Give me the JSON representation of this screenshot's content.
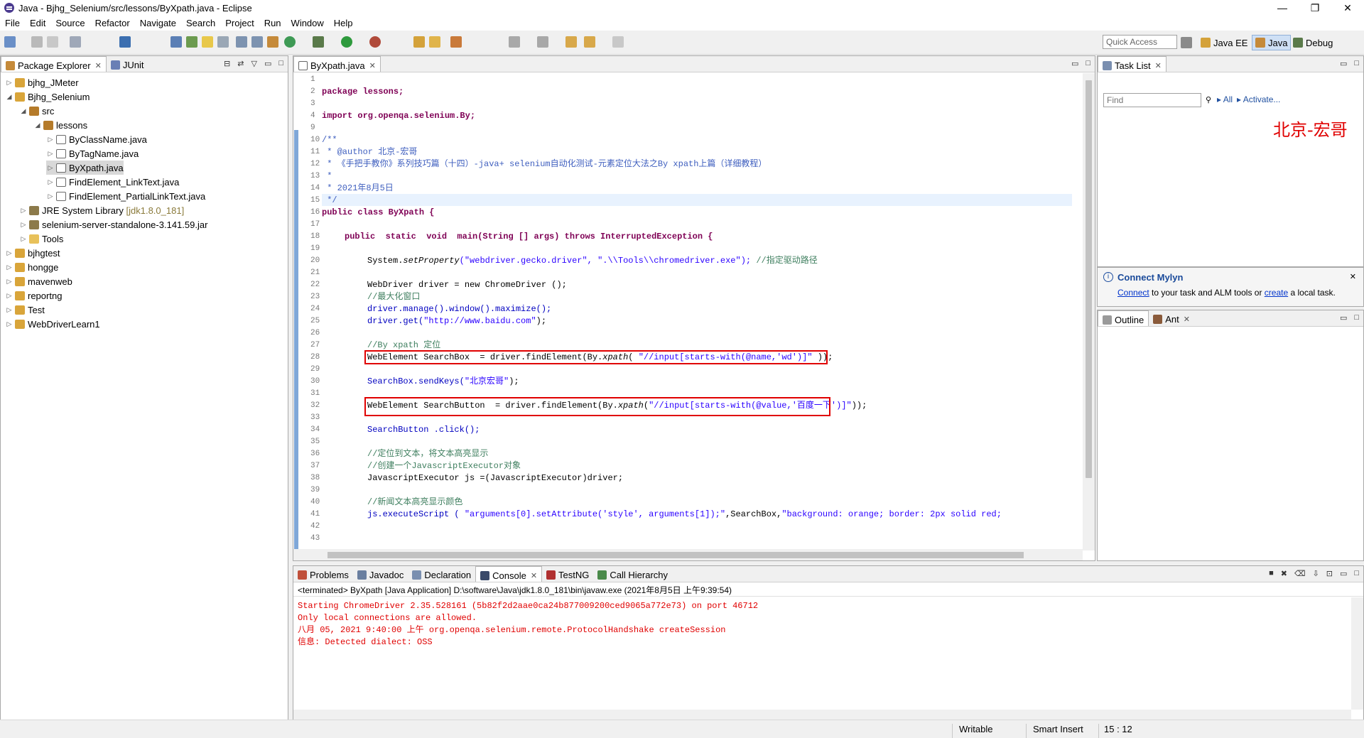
{
  "window": {
    "title": "Java - Bjhg_Selenium/src/lessons/ByXpath.java - Eclipse",
    "min": "—",
    "max": "❐",
    "close": "✕"
  },
  "menu": [
    "File",
    "Edit",
    "Source",
    "Refactor",
    "Navigate",
    "Search",
    "Project",
    "Run",
    "Window",
    "Help"
  ],
  "toolbar": {
    "quick_access": "Quick Access",
    "perspectives": [
      "Java EE",
      "Java",
      "Debug"
    ]
  },
  "package_explorer": {
    "tabs": [
      "Package Explorer",
      "JUnit"
    ],
    "tree": [
      {
        "label": "bjhg_JMeter"
      },
      {
        "label": "Bjhg_Selenium"
      },
      {
        "label": "src"
      },
      {
        "label": "lessons"
      },
      {
        "label": "ByClassName.java"
      },
      {
        "label": "ByTagName.java"
      },
      {
        "label": "ByXpath.java"
      },
      {
        "label": "FindElement_LinkText.java"
      },
      {
        "label": "FindElement_PartialLinkText.java"
      },
      {
        "label": "JRE System Library",
        "suffix": "[jdk1.8.0_181]"
      },
      {
        "label": "selenium-server-standalone-3.141.59.jar"
      },
      {
        "label": "Tools"
      },
      {
        "label": "bjhgtest"
      },
      {
        "label": "hongge"
      },
      {
        "label": "mavenweb"
      },
      {
        "label": "reportng"
      },
      {
        "label": "Test"
      },
      {
        "label": "WebDriverLearn1"
      }
    ]
  },
  "editor": {
    "tab": "ByXpath.java",
    "line_numbers": [
      "1",
      "2",
      "3",
      "4",
      "9",
      "10",
      "11",
      "12",
      "13",
      "14",
      "15",
      "16",
      "17",
      "18",
      "19",
      "20",
      "21",
      "22",
      "23",
      "24",
      "25",
      "26",
      "27",
      "28",
      "29",
      "30",
      "31",
      "32",
      "33",
      "34",
      "35",
      "36",
      "37",
      "38",
      "39",
      "40",
      "41",
      "42",
      "43"
    ],
    "lines": {
      "l2": "package lessons;",
      "l4": "import org.openqa.selenium.By;",
      "l10": "/**",
      "l11a": " * @author ",
      "l11b": "北京-宏哥",
      "l12": " * 《手把手教你》系列技巧篇（十四）-java+ selenium自动化测试-元素定位大法之By xpath上篇（详细教程）",
      "l13": " *",
      "l14": " * 2021年8月5日",
      "l15": " */",
      "l16": "public class ByXpath {",
      "l18": "public  static  void  main(String [] args) throws InterruptedException {",
      "l20a": "System.",
      "l20b": "setProperty",
      "l20c": "(\"webdriver.gecko.driver\", \".\\\\Tools\\\\chromedriver.exe\"); ",
      "l20d": "//指定驱动路径",
      "l22": "WebDriver driver = new ChromeDriver ();",
      "l23": "//最大化窗口",
      "l24": "driver.manage().window().maximize();",
      "l25a": "driver.get(",
      "l25b": "\"http://www.baidu.com\"",
      "l25c": ");",
      "l27": "//By xpath 定位",
      "l28a": "WebElement SearchBox  = driver.findElement(By.",
      "l28b": "xpath",
      "l28c": "( ",
      "l28d": "\"//input[starts-with(@name,'wd')]\"",
      "l28e": " ));",
      "l30a": "SearchBox.sendKeys(",
      "l30b": "\"北京宏哥\"",
      "l30c": ");",
      "l32a": "WebElement SearchButton  = driver.findElement(By.",
      "l32b": "xpath",
      "l32c": "(",
      "l32d": "\"//input[starts-with(@value,'百度一下')]\"",
      "l32e": "));",
      "l34": "SearchButton .click();",
      "l36": "//定位到文本，将文本高亮显示",
      "l37": "//创建一个JavascriptExecutor对象",
      "l38": "JavascriptExecutor js =(JavascriptExecutor)driver;",
      "l40": "//新闻文本高亮显示颜色",
      "l41a": "js.executeScript ( ",
      "l41b": "\"arguments[0].setAttribute('style', arguments[1]);\"",
      "l41c": ",SearchBox,",
      "l41d": "\"background: orange; border: 2px solid red;"
    }
  },
  "task_list": {
    "tab": "Task List",
    "find_placeholder": "Find",
    "all": "All",
    "activate": "Activate..."
  },
  "watermark": "北京-宏哥",
  "mylyn": {
    "title": "Connect Mylyn",
    "connect": "Connect",
    "text1": " to your task and ALM tools or ",
    "create": "create",
    "text2": " a local task."
  },
  "outline": {
    "tabs": [
      "Outline",
      "Ant"
    ]
  },
  "bottom": {
    "tabs": [
      "Problems",
      "Javadoc",
      "Declaration",
      "Console",
      "TestNG",
      "Call Hierarchy"
    ],
    "header": "<terminated> ByXpath [Java Application] D:\\software\\Java\\jdk1.8.0_181\\bin\\javaw.exe (2021年8月5日 上午9:39:54)",
    "lines": [
      "Starting ChromeDriver 2.35.528161 (5b82f2d2aae0ca24b877009200ced9065a772e73) on port 46712",
      "Only local connections are allowed.",
      "八月 05, 2021 9:40:00 上午 org.openqa.selenium.remote.ProtocolHandshake createSession",
      "信息: Detected dialect: OSS"
    ]
  },
  "status": {
    "writable": "Writable",
    "insert": "Smart Insert",
    "position": "15 : 12"
  },
  "colors": {
    "accent": "#7fa7d8",
    "highlight_box": "#e00000",
    "keyword": "#7f0055",
    "string": "#2a00ff",
    "comment": "#3f7f5f"
  }
}
